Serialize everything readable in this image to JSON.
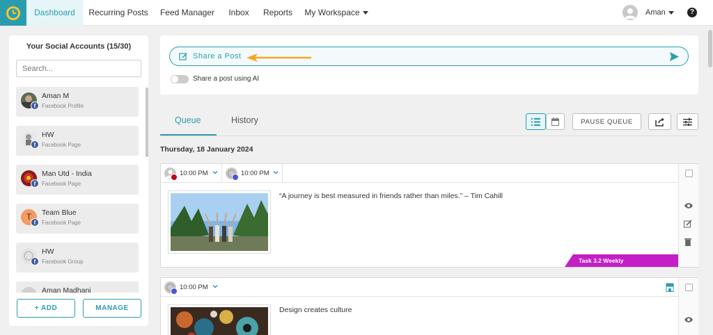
{
  "nav": {
    "items": [
      {
        "label": "Dashboard",
        "active": true
      },
      {
        "label": "Recurring Posts",
        "active": false
      },
      {
        "label": "Feed Manager",
        "active": false
      },
      {
        "label": "Inbox",
        "active": false
      },
      {
        "label": "Reports",
        "active": false
      },
      {
        "label": "My Workspace",
        "active": false
      }
    ],
    "user_name": "Aman",
    "help_label": "?"
  },
  "accounts_panel": {
    "title": "Your Social Accounts (15/30)",
    "search_placeholder": "Search...",
    "accounts": [
      {
        "name": "Aman M",
        "type": "Facebook Profile"
      },
      {
        "name": "HW",
        "type": "Facebook Page"
      },
      {
        "name": "Man Utd - India",
        "type": "Facebook Page"
      },
      {
        "name": "Team Blue",
        "type": "Facebook Page",
        "initial": "T"
      },
      {
        "name": "HW",
        "type": "Facebook Group"
      },
      {
        "name": "Aman Madhani",
        "type": ""
      }
    ],
    "add_label": "+ ADD",
    "manage_label": "MANAGE"
  },
  "share": {
    "label": "Share a Post",
    "ai_toggle_label": "Share a post using AI"
  },
  "queue": {
    "tabs": [
      {
        "label": "Queue",
        "active": true
      },
      {
        "label": "History",
        "active": false
      }
    ],
    "pause_label": "PAUSE QUEUE",
    "date_heading": "Thursday, 18 January 2024",
    "posts": [
      {
        "slots": [
          {
            "time": "10:00 PM",
            "network": "pinterest"
          },
          {
            "time": "10:00 PM",
            "network": "google-business"
          }
        ],
        "text": "“A journey is best measured in friends rather than miles.” – Tim Cahill",
        "tag": "Task 3.2 Weekly"
      },
      {
        "slots": [
          {
            "time": "10:00 PM",
            "network": "google-business"
          }
        ],
        "text": "Design creates culture"
      }
    ]
  },
  "colors": {
    "accent": "#2b9cae",
    "tag": "#c41ec6",
    "arrow": "#f5a623",
    "facebook": "#3b5998"
  }
}
